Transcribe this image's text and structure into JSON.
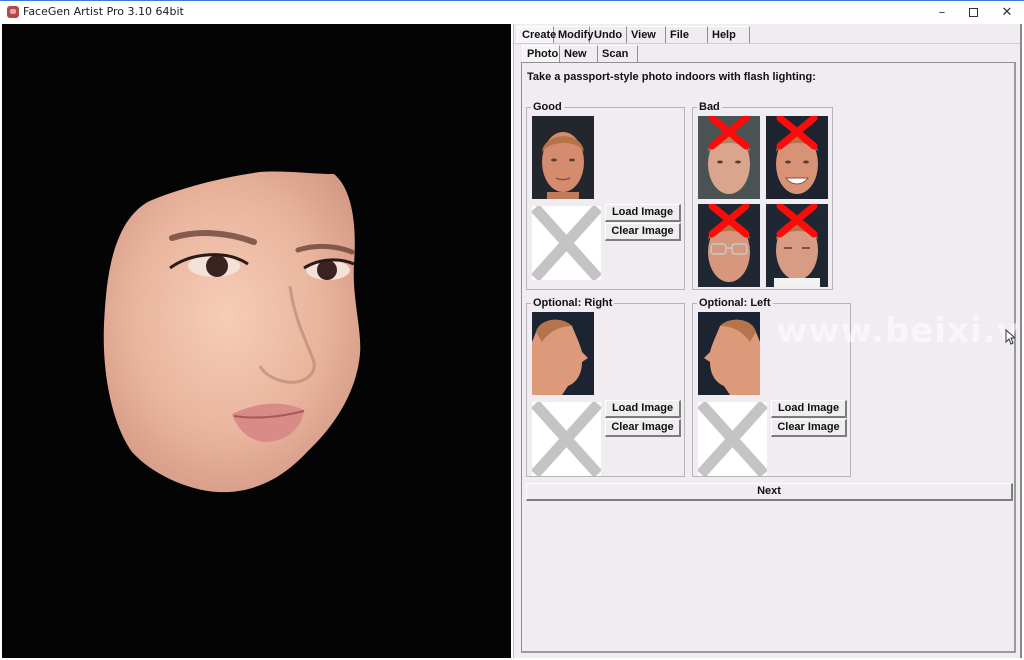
{
  "window": {
    "title": "FaceGen Artist Pro 3.10 64bit",
    "controls": {
      "minimize": "–",
      "close": "✕"
    }
  },
  "tabs_main": [
    {
      "label": "Create",
      "active": true
    },
    {
      "label": "Modify",
      "active": false
    },
    {
      "label": "Undo",
      "active": false
    },
    {
      "label": "View",
      "active": false
    },
    {
      "label": "File",
      "active": false
    },
    {
      "label": "Help",
      "active": false
    }
  ],
  "tabs_sub": [
    {
      "label": "Photo",
      "active": true
    },
    {
      "label": "New",
      "active": false
    },
    {
      "label": "Scan",
      "active": false
    }
  ],
  "photo_page": {
    "instruction": "Take a passport-style photo indoors with flash lighting:",
    "groups": {
      "good": {
        "label": "Good",
        "load_label": "Load Image",
        "clear_label": "Clear Image"
      },
      "bad": {
        "label": "Bad",
        "examples": [
          "shadowed-lighting",
          "smiling",
          "glasses",
          "squinting"
        ]
      },
      "right": {
        "label": "Optional: Right",
        "load_label": "Load Image",
        "clear_label": "Clear Image"
      },
      "left": {
        "label": "Optional: Left",
        "load_label": "Load Image",
        "clear_label": "Clear Image"
      }
    },
    "next_label": "Next"
  },
  "watermark": "www.beixi.vip",
  "colors": {
    "panel_bg": "#f0ecf1",
    "viewport_bg": "#040404",
    "bad_mark": "#ff0a0a",
    "placeholder_x": "#c4c4c4"
  }
}
